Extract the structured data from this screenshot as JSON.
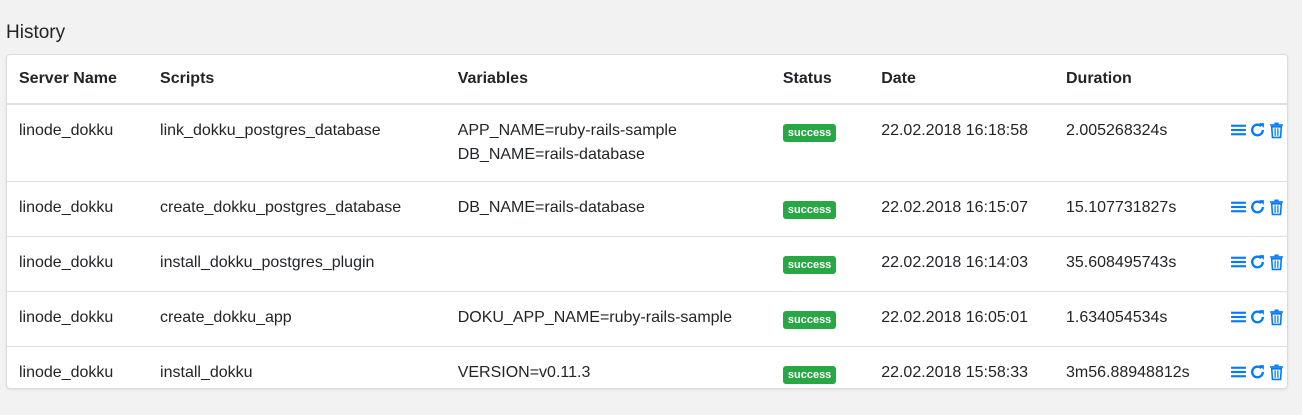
{
  "page": {
    "title": "History"
  },
  "table": {
    "headers": [
      "Server Name",
      "Scripts",
      "Variables",
      "Status",
      "Date",
      "Duration"
    ],
    "rows": [
      {
        "server": "linode_dokku",
        "script": "link_dokku_postgres_database",
        "variables": [
          "APP_NAME=ruby-rails-sample",
          "DB_NAME=rails-database"
        ],
        "status": "success",
        "date": "22.02.2018 16:18:58",
        "duration": "2.005268324s"
      },
      {
        "server": "linode_dokku",
        "script": "create_dokku_postgres_database",
        "variables": [
          "DB_NAME=rails-database"
        ],
        "status": "success",
        "date": "22.02.2018 16:15:07",
        "duration": "15.107731827s"
      },
      {
        "server": "linode_dokku",
        "script": "install_dokku_postgres_plugin",
        "variables": [],
        "status": "success",
        "date": "22.02.2018 16:14:03",
        "duration": "35.608495743s"
      },
      {
        "server": "linode_dokku",
        "script": "create_dokku_app",
        "variables": [
          "DOKU_APP_NAME=ruby-rails-sample"
        ],
        "status": "success",
        "date": "22.02.2018 16:05:01",
        "duration": "1.634054534s"
      },
      {
        "server": "linode_dokku",
        "script": "install_dokku",
        "variables": [
          "VERSION=v0.11.3"
        ],
        "status": "success",
        "date": "22.02.2018 15:58:33",
        "duration": "3m56.88948812s"
      }
    ]
  },
  "row_actions": [
    "list-icon",
    "redo-icon",
    "trash-icon"
  ],
  "colors": {
    "success": "#28a745",
    "action_icon": "#007bff",
    "background": "#f2f2f2"
  }
}
